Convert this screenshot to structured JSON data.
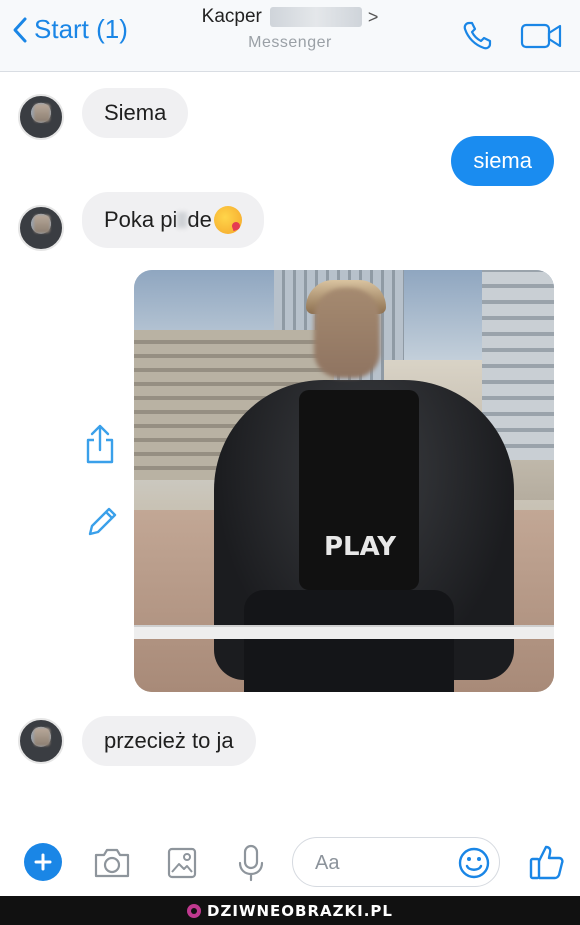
{
  "header": {
    "back_label": "Start (1)",
    "contact_name": "Kacper",
    "subtitle": "Messenger"
  },
  "messages": [
    {
      "direction": "in",
      "text": "Siema"
    },
    {
      "direction": "out",
      "text": "siema"
    },
    {
      "direction": "in",
      "text": "Poka pi",
      "text_after_blur": "de",
      "emoji": "kissing-heart-emoji"
    },
    {
      "direction": "in",
      "type": "photo",
      "shirt_text": "PLAY"
    },
    {
      "direction": "in",
      "text": "przecież to ja"
    }
  ],
  "composer": {
    "placeholder": "Aa"
  },
  "watermark": {
    "text": "DZIWNEOBRAZKI.PL"
  },
  "colors": {
    "accent": "#1a86e6",
    "outgoing_bubble": "#1a8cf0",
    "incoming_bubble": "#f0f0f2"
  },
  "icons": [
    "chevron-left-icon",
    "phone-icon",
    "video-camera-icon",
    "share-icon",
    "pencil-icon",
    "plus-icon",
    "camera-icon",
    "image-icon",
    "microphone-icon",
    "smiley-icon",
    "thumbs-up-icon"
  ]
}
